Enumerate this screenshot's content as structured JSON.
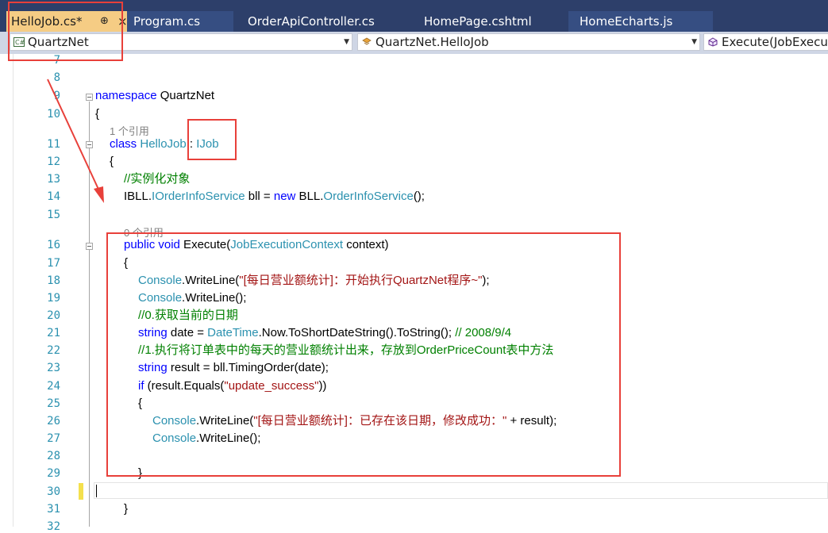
{
  "tabs": [
    {
      "label": "HelloJob.cs*",
      "active": true,
      "pin": "⊕",
      "close": "×"
    },
    {
      "label": "Program.cs"
    },
    {
      "label": "OrderApiController.cs"
    },
    {
      "label": "HomePage.cshtml"
    },
    {
      "label": "HomeEcharts.js"
    }
  ],
  "navbar": {
    "project": "QuartzNet",
    "type": "QuartzNet.HelloJob",
    "member": "Execute(JobExecu"
  },
  "line_numbers": [
    "7",
    "8",
    "9",
    "10",
    "11",
    "12",
    "13",
    "14",
    "15",
    "16",
    "17",
    "18",
    "19",
    "20",
    "21",
    "22",
    "23",
    "24",
    "25",
    "26",
    "27",
    "28",
    "29",
    "30",
    "31",
    "32"
  ],
  "code": {
    "l9_kw": "namespace",
    "l9_name": " QuartzNet",
    "l10": "{",
    "ref1": "1 个引用",
    "l11_kw": "class",
    "l11_name": "HelloJob",
    "l11_sep": " : ",
    "l11_iface": "IJob",
    "l12": "{",
    "l13": "//实例化对象",
    "l14_a": "IBLL.",
    "l14_b": "IOrderInfoService",
    "l14_c": " bll = ",
    "l14_d": "new",
    "l14_e": " BLL.",
    "l14_f": "OrderInfoService",
    "l14_g": "();",
    "ref0": "0 个引用",
    "l16_a": "public void",
    "l16_b": " Execute(",
    "l16_c": "JobExecutionContext",
    "l16_d": " context)",
    "l17": "{",
    "l18_a": "Console",
    "l18_b": ".WriteLine(",
    "l18_c": "\"[每日营业额统计]：开始执行QuartzNet程序~\"",
    "l18_d": ");",
    "l19_a": "Console",
    "l19_b": ".WriteLine();",
    "l20": "//0.获取当前的日期",
    "l21_a": "string",
    "l21_b": " date = ",
    "l21_c": "DateTime",
    "l21_d": ".Now.ToShortDateString().ToString(); ",
    "l21_e": "// 2008/9/4",
    "l22": "//1.执行将订单表中的每天的营业额统计出来，存放到OrderPriceCount表中方法",
    "l23_a": "string",
    "l23_b": " result = bll.TimingOrder(date);",
    "l24_a": "if",
    "l24_b": " (result.Equals(",
    "l24_c": "\"update_success\"",
    "l24_d": "))",
    "l25": "{",
    "l26_a": "Console",
    "l26_b": ".WriteLine(",
    "l26_c": "\"[每日营业额统计]：已存在该日期，修改成功：\"",
    "l26_d": " + result);",
    "l27_a": "Console",
    "l27_b": ".WriteLine();",
    "l29": "}",
    "l31": "}"
  },
  "colors": {
    "keyword": "#0000ff",
    "type": "#2b91af",
    "string": "#a31515",
    "comment": "#008000",
    "annotation": "#e8403a"
  }
}
